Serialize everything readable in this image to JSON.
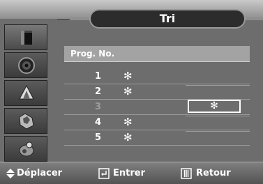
{
  "menu": {
    "title": "Tri",
    "header": "Prog. No.",
    "sidebar": [
      {
        "icon": "picture-icon",
        "active": true
      },
      {
        "icon": "sound-icon",
        "active": false
      },
      {
        "icon": "channel-icon",
        "active": false
      },
      {
        "icon": "setup-icon",
        "active": false
      },
      {
        "icon": "input-icon",
        "active": false
      }
    ],
    "rows": [
      {
        "num": "1",
        "star": "✻",
        "dim": false
      },
      {
        "num": "2",
        "star": "✻",
        "dim": false
      },
      {
        "num": "3",
        "star": "",
        "dim": true
      },
      {
        "num": "4",
        "star": "✻",
        "dim": false
      },
      {
        "num": "5",
        "star": "✻",
        "dim": false
      }
    ],
    "selection_star": "✻"
  },
  "footer": {
    "move_label": "Déplacer",
    "enter_label": "Entrer",
    "return_label": "Retour"
  },
  "colors": {
    "background": "#6d6d6d",
    "header": "#a3a3a3",
    "title_pill": "#2c2c2c",
    "text": "#ffffff",
    "dim_text": "#9c9c9c"
  }
}
